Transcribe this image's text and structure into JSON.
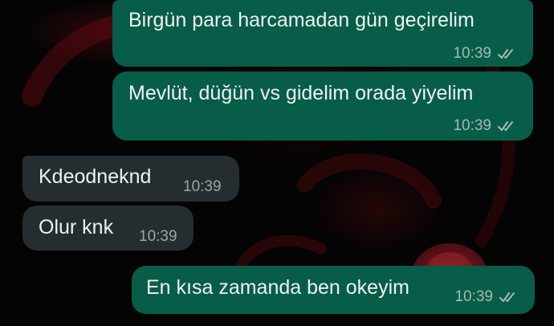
{
  "messages": [
    {
      "direction": "outgoing",
      "text": "Birgün para harcamadan gün geçirelim",
      "time": "10:39",
      "status": "read"
    },
    {
      "direction": "outgoing",
      "text": "Mevlüt, düğün vs gidelim orada yiyelim",
      "time": "10:39",
      "status": "read"
    },
    {
      "direction": "incoming",
      "text": "Kdeodneknd",
      "time": "10:39"
    },
    {
      "direction": "incoming",
      "text": "Olur knk",
      "time": "10:39"
    },
    {
      "direction": "outgoing",
      "text": "En kısa zamanda ben okeyim",
      "time": "10:39",
      "status": "read"
    }
  ],
  "colors": {
    "outgoing_bubble": "#075d48",
    "incoming_bubble": "#252d31",
    "background": "#050505"
  },
  "icons": {
    "read_receipt": "double-check-icon"
  }
}
